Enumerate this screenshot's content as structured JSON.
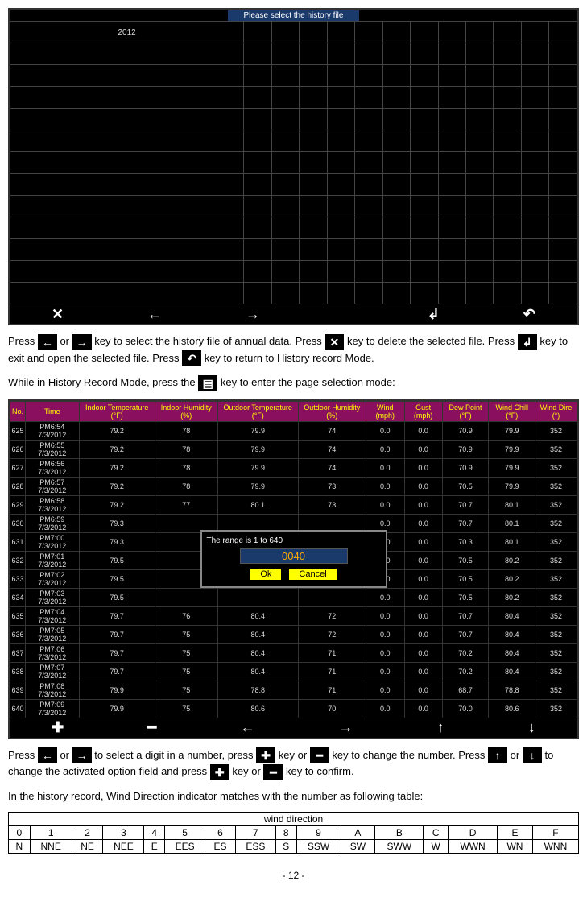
{
  "screenshot1": {
    "header": "Please select the history file",
    "first_cell": "2012",
    "footer_icons": [
      "✕",
      "←",
      "→",
      "↲",
      "↶"
    ]
  },
  "para1": {
    "t1": "Press ",
    "t2": " or ",
    "t3": " key to select the history file of annual data.    Press ",
    "t4": " key to delete the selected file. Press ",
    "t5": " key to exit and open the selected file. Press ",
    "t6": " key to return to History record Mode."
  },
  "para2": {
    "t1": "While in History Record Mode, press the ",
    "t2": " key to enter the page selection mode:"
  },
  "screenshot2": {
    "headers": [
      "No.",
      "Time",
      "Indoor Temperature (°F)",
      "Indoor Humidity (%)",
      "Outdoor Temperature (°F)",
      "Outdoor Humidity (%)",
      "Wind (mph)",
      "Gust (mph)",
      "Dew Point (°F)",
      "Wind Chill (°F)",
      "Wind Dire (°)"
    ],
    "rows": [
      [
        "625",
        "PM6:54 7/3/2012",
        "79.2",
        "78",
        "79.9",
        "74",
        "0.0",
        "0.0",
        "70.9",
        "79.9",
        "352"
      ],
      [
        "626",
        "PM6:55 7/3/2012",
        "79.2",
        "78",
        "79.9",
        "74",
        "0.0",
        "0.0",
        "70.9",
        "79.9",
        "352"
      ],
      [
        "627",
        "PM6:56 7/3/2012",
        "79.2",
        "78",
        "79.9",
        "74",
        "0.0",
        "0.0",
        "70.9",
        "79.9",
        "352"
      ],
      [
        "628",
        "PM6:57 7/3/2012",
        "79.2",
        "78",
        "79.9",
        "73",
        "0.0",
        "0.0",
        "70.5",
        "79.9",
        "352"
      ],
      [
        "629",
        "PM6:58 7/3/2012",
        "79.2",
        "77",
        "80.1",
        "73",
        "0.0",
        "0.0",
        "70.7",
        "80.1",
        "352"
      ],
      [
        "630",
        "PM6:59 7/3/2012",
        "79.3",
        "",
        "",
        "",
        "0.0",
        "0.0",
        "70.7",
        "80.1",
        "352"
      ],
      [
        "631",
        "PM7:00 7/3/2012",
        "79.3",
        "",
        "",
        "",
        "0.0",
        "0.0",
        "70.3",
        "80.1",
        "352"
      ],
      [
        "632",
        "PM7:01 7/3/2012",
        "79.5",
        "",
        "",
        "",
        "0.0",
        "0.0",
        "70.5",
        "80.2",
        "352"
      ],
      [
        "633",
        "PM7:02 7/3/2012",
        "79.5",
        "",
        "",
        "",
        "0.0",
        "0.0",
        "70.5",
        "80.2",
        "352"
      ],
      [
        "634",
        "PM7:03 7/3/2012",
        "79.5",
        "",
        "",
        "",
        "0.0",
        "0.0",
        "70.5",
        "80.2",
        "352"
      ],
      [
        "635",
        "PM7:04 7/3/2012",
        "79.7",
        "76",
        "80.4",
        "72",
        "0.0",
        "0.0",
        "70.7",
        "80.4",
        "352"
      ],
      [
        "636",
        "PM7:05 7/3/2012",
        "79.7",
        "75",
        "80.4",
        "72",
        "0.0",
        "0.0",
        "70.7",
        "80.4",
        "352"
      ],
      [
        "637",
        "PM7:06 7/3/2012",
        "79.7",
        "75",
        "80.4",
        "71",
        "0.0",
        "0.0",
        "70.2",
        "80.4",
        "352"
      ],
      [
        "638",
        "PM7:07 7/3/2012",
        "79.7",
        "75",
        "80.4",
        "71",
        "0.0",
        "0.0",
        "70.2",
        "80.4",
        "352"
      ],
      [
        "639",
        "PM7:08 7/3/2012",
        "79.9",
        "75",
        "78.8",
        "71",
        "0.0",
        "0.0",
        "68.7",
        "78.8",
        "352"
      ],
      [
        "640",
        "PM7:09 7/3/2012",
        "79.9",
        "75",
        "80.6",
        "70",
        "0.0",
        "0.0",
        "70.0",
        "80.6",
        "352"
      ]
    ],
    "dialog": {
      "range": "The range is 1 to 640",
      "value": "0040",
      "ok": "Ok",
      "cancel": "Cancel"
    },
    "footer_icons": [
      "✚",
      "━",
      "←",
      "→",
      "↑",
      "↓"
    ]
  },
  "para3": {
    "t1": "Press ",
    "t2": " or ",
    "t3": " to select a digit in a number, press ",
    "t4": " key or ",
    "t5": " key to change the number. Press ",
    "t6": " or ",
    "t7": " to change the activated option field and press ",
    "t8": " key or ",
    "t9": " key to confirm."
  },
  "para4": "In the history record, Wind Direction indicator matches with the number as following table:",
  "wind_table": {
    "title": "wind direction",
    "row1": [
      "0",
      "1",
      "2",
      "3",
      "4",
      "5",
      "6",
      "7",
      "8",
      "9",
      "A",
      "B",
      "C",
      "D",
      "E",
      "F"
    ],
    "row2": [
      "N",
      "NNE",
      "NE",
      "NEE",
      "E",
      "EES",
      "ES",
      "ESS",
      "S",
      "SSW",
      "SW",
      "SWW",
      "W",
      "WWN",
      "WN",
      "WNN"
    ]
  },
  "page": "- 12 -",
  "icons": {
    "left": "←",
    "right": "→",
    "x": "✕",
    "enter": "↲",
    "back": "↶",
    "list": "▤",
    "plus": "✚",
    "minus": "━",
    "up": "↑",
    "down": "↓"
  }
}
